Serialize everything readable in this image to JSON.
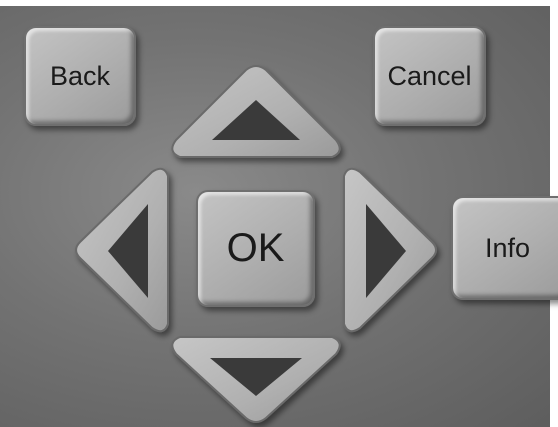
{
  "remote": {
    "back_label": "Back",
    "cancel_label": "Cancel",
    "ok_label": "OK",
    "info_label": "Info",
    "arrows": [
      "up",
      "down",
      "left",
      "right"
    ]
  },
  "colors": {
    "background": "#737373",
    "button_face": "#b4b4b4",
    "arrow_glyph": "#3a3a3a"
  }
}
